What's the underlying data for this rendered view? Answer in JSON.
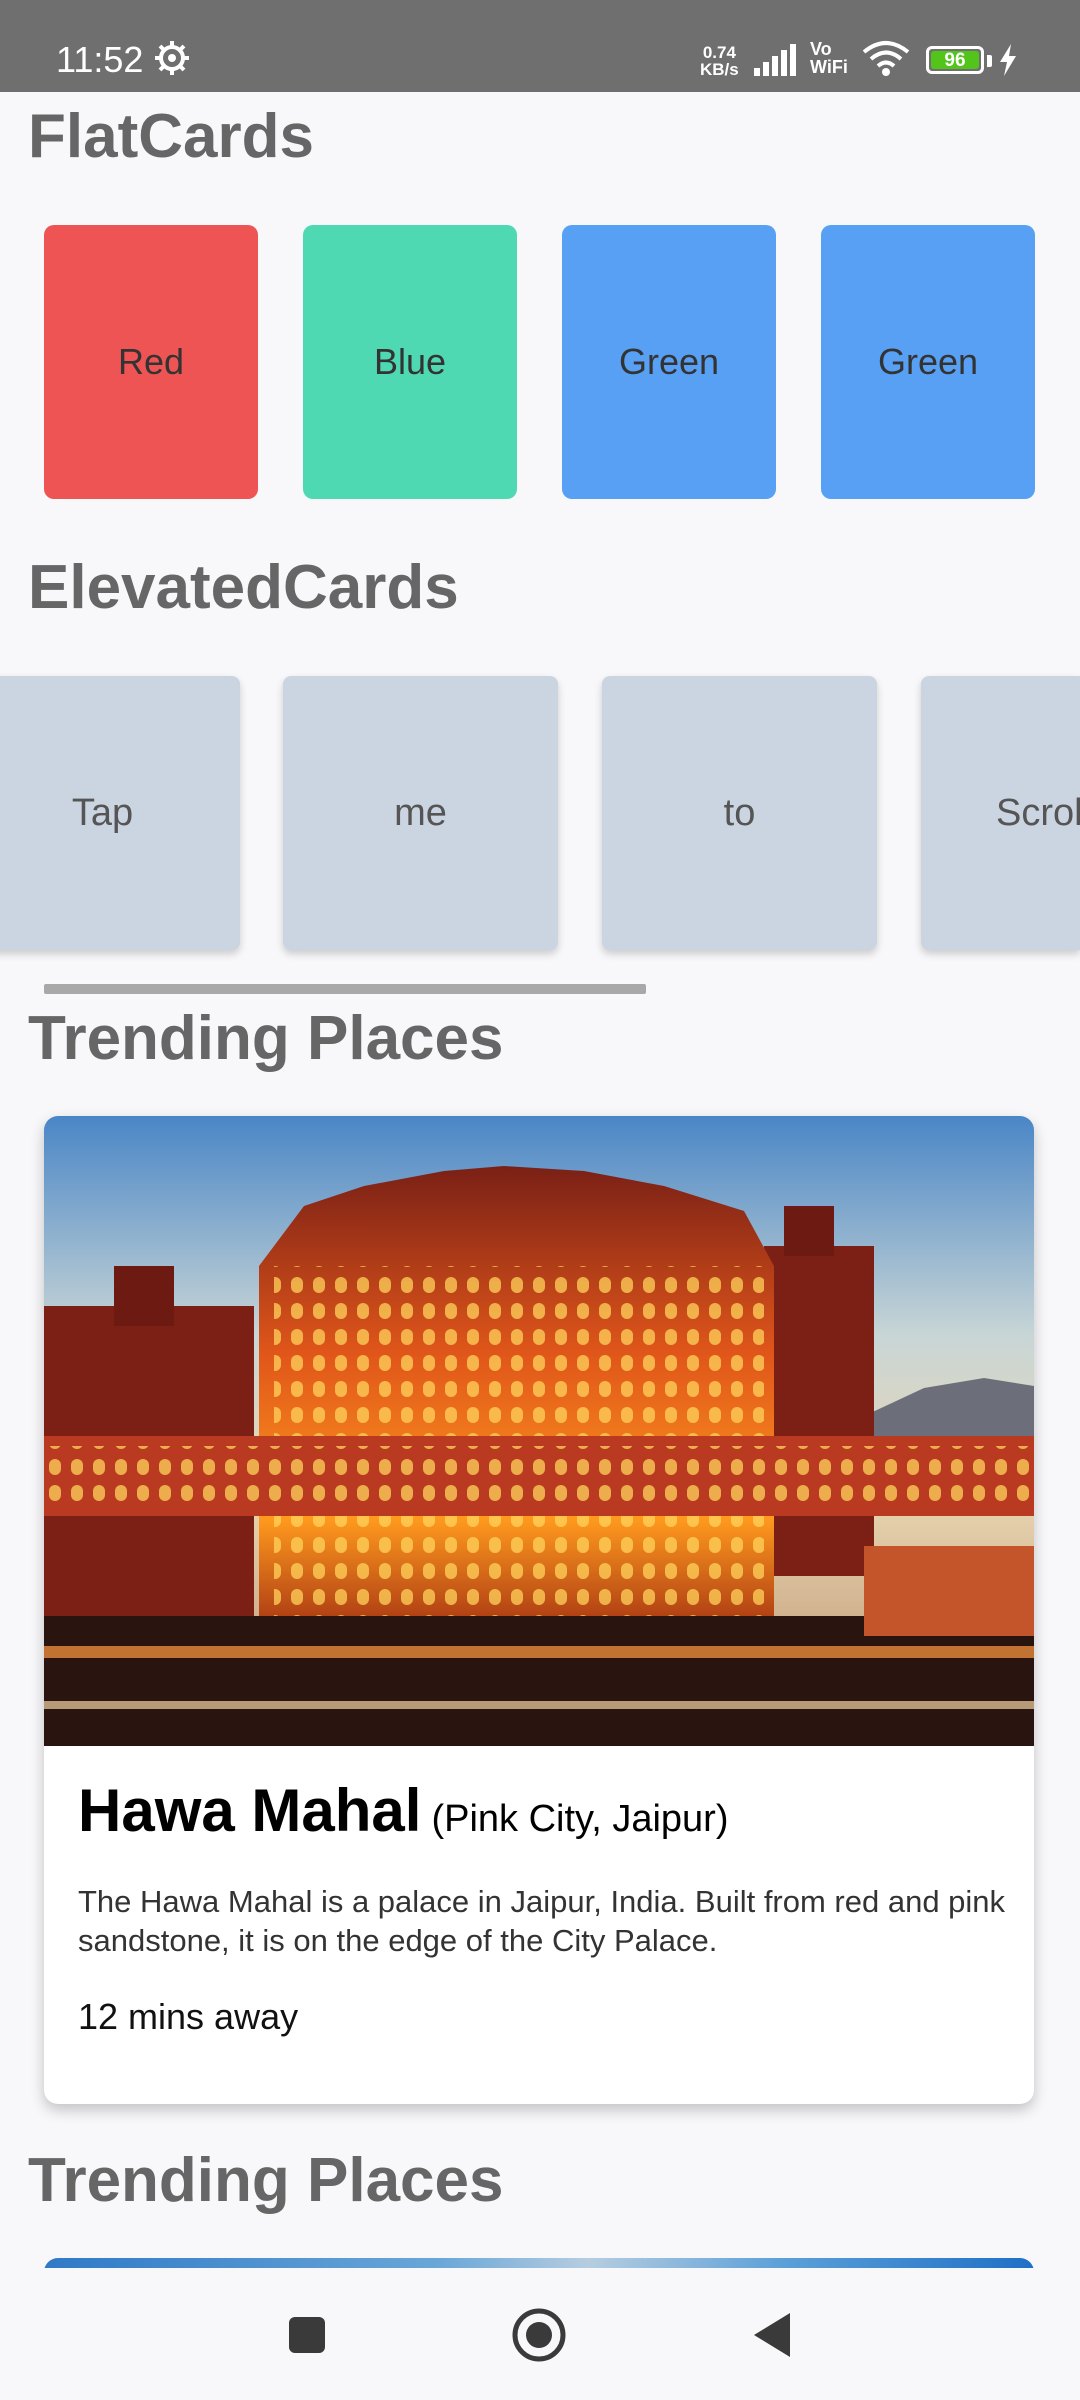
{
  "status_bar": {
    "time": "11:52",
    "net_speed_value": "0.74",
    "net_speed_unit": "KB/s",
    "vo_label": "Vo",
    "wifi_label": "WiFi",
    "battery_level": "96",
    "icons": [
      "gear-icon",
      "signal-icon",
      "wifi-icon",
      "battery-icon",
      "charging-bolt-icon"
    ]
  },
  "flat_cards": {
    "heading": "FlatCards",
    "cards": [
      {
        "label": "Red",
        "color": "#ef5454"
      },
      {
        "label": "Blue",
        "color": "#4fd9b2"
      },
      {
        "label": "Green",
        "color": "#58a0f4"
      },
      {
        "label": "Green",
        "color": "#58a0f4"
      }
    ]
  },
  "elevated_cards": {
    "heading": "ElevatedCards",
    "cards": [
      {
        "label": "Tap"
      },
      {
        "label": "me"
      },
      {
        "label": "to"
      },
      {
        "label": "Scroll"
      }
    ]
  },
  "trending": {
    "heading": "Trending Places",
    "card": {
      "image_name": "hawa-mahal-photo",
      "title": "Hawa Mahal",
      "subtitle": "(Pink City, Jaipur)",
      "description": "The Hawa Mahal is a palace in Jaipur, India. Built from red and pink sandstone, it is on the edge of the City Palace.",
      "distance": "12 mins away"
    }
  },
  "trending_second": {
    "heading": "Trending Places"
  },
  "nav_bar": {
    "icons": [
      "recents-square-icon",
      "home-circle-icon",
      "back-triangle-icon"
    ]
  }
}
